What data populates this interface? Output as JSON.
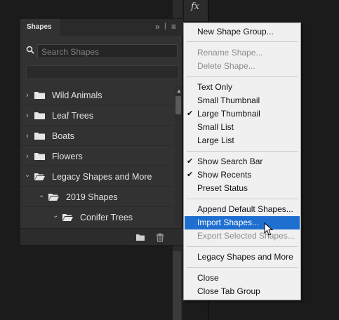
{
  "app": {
    "fx_label": "fx"
  },
  "panel": {
    "tab_title": "Shapes",
    "collapse_glyph": "»",
    "menu_glyph": "≡",
    "search_placeholder": "Search Shapes",
    "rows": [
      {
        "label": "Wild Animals",
        "icon": "chevron-right-icon"
      },
      {
        "label": "Leaf Trees",
        "icon": "chevron-right-icon"
      },
      {
        "label": "Boats",
        "icon": "chevron-right-icon"
      },
      {
        "label": "Flowers",
        "icon": "chevron-right-icon"
      },
      {
        "label": "Legacy Shapes and More",
        "icon": "chevron-down-icon"
      },
      {
        "label": "2019 Shapes",
        "icon": "chevron-down-icon"
      },
      {
        "label": "Conifer Trees",
        "icon": "chevron-down-icon"
      }
    ]
  },
  "menu": {
    "items": [
      {
        "label": "New Shape Group...",
        "enabled": true,
        "checked": false
      },
      {
        "label": "Rename Shape...",
        "enabled": false,
        "checked": false
      },
      {
        "label": "Delete Shape...",
        "enabled": false,
        "checked": false
      },
      {
        "label": "Text Only",
        "enabled": true,
        "checked": false
      },
      {
        "label": "Small Thumbnail",
        "enabled": true,
        "checked": false
      },
      {
        "label": "Large Thumbnail",
        "enabled": true,
        "checked": true
      },
      {
        "label": "Small List",
        "enabled": true,
        "checked": false
      },
      {
        "label": "Large List",
        "enabled": true,
        "checked": false
      },
      {
        "label": "Show Search Bar",
        "enabled": true,
        "checked": true
      },
      {
        "label": "Show Recents",
        "enabled": true,
        "checked": true
      },
      {
        "label": "Preset Status",
        "enabled": true,
        "checked": false
      },
      {
        "label": "Append Default Shapes...",
        "enabled": true,
        "checked": false
      },
      {
        "label": "Import Shapes...",
        "enabled": true,
        "checked": false,
        "highlighted": true
      },
      {
        "label": "Export Selected Shapes...",
        "enabled": false,
        "checked": false
      },
      {
        "label": "Legacy Shapes and More",
        "enabled": true,
        "checked": false
      },
      {
        "label": "Close",
        "enabled": true,
        "checked": false
      },
      {
        "label": "Close Tab Group",
        "enabled": true,
        "checked": false
      }
    ],
    "check_glyph": "✔"
  },
  "colors": {
    "highlight": "#1f6fd0",
    "menu_bg": "#f0f0f0",
    "panel_bg": "#323232"
  }
}
